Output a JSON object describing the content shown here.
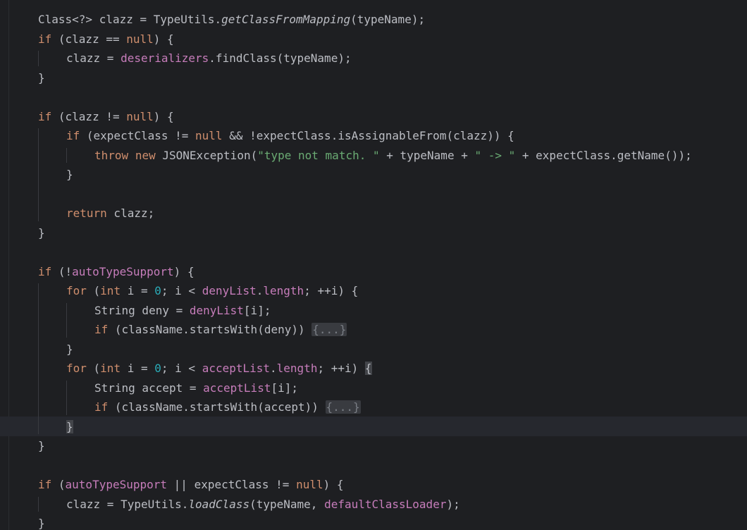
{
  "editor": {
    "language": "java",
    "colors": {
      "background": "#1e1f22",
      "text": "#bcbec4",
      "keyword": "#cf8e6d",
      "field": "#c77dbb",
      "number": "#2aacb8",
      "string": "#6aab73",
      "fold_placeholder_bg": "#393b40",
      "current_line": "#26282e"
    },
    "folded_placeholder": "{...}",
    "lines": [
      {
        "indent": 1,
        "tokens": [
          {
            "t": "Class<?> clazz = TypeUtils."
          },
          {
            "t": "getClassFromMapping",
            "s": "it"
          },
          {
            "t": "(typeName);"
          }
        ]
      },
      {
        "indent": 1,
        "tokens": [
          {
            "t": "if",
            "s": "kw"
          },
          {
            "t": " (clazz == "
          },
          {
            "t": "null",
            "s": "kw"
          },
          {
            "t": ") {"
          }
        ]
      },
      {
        "indent": 2,
        "tokens": [
          {
            "t": "clazz = "
          },
          {
            "t": "deserializers",
            "s": "fld"
          },
          {
            "t": ".findClass(typeName);"
          }
        ]
      },
      {
        "indent": 1,
        "tokens": [
          {
            "t": "}"
          }
        ]
      },
      {
        "indent": 0,
        "tokens": []
      },
      {
        "indent": 1,
        "tokens": [
          {
            "t": "if",
            "s": "kw"
          },
          {
            "t": " (clazz != "
          },
          {
            "t": "null",
            "s": "kw"
          },
          {
            "t": ") {"
          }
        ]
      },
      {
        "indent": 2,
        "tokens": [
          {
            "t": "if",
            "s": "kw"
          },
          {
            "t": " (expectClass != "
          },
          {
            "t": "null",
            "s": "kw"
          },
          {
            "t": " && !expectClass.isAssignableFrom(clazz)) {"
          }
        ]
      },
      {
        "indent": 3,
        "tokens": [
          {
            "t": "throw",
            "s": "kw"
          },
          {
            "t": " "
          },
          {
            "t": "new",
            "s": "kw"
          },
          {
            "t": " JSONException("
          },
          {
            "t": "\"type not match. \"",
            "s": "str"
          },
          {
            "t": " + typeName + "
          },
          {
            "t": "\" -> \"",
            "s": "str"
          },
          {
            "t": " + expectClass.getName());"
          }
        ]
      },
      {
        "indent": 2,
        "tokens": [
          {
            "t": "}"
          }
        ]
      },
      {
        "indent": 0,
        "tokens": []
      },
      {
        "indent": 2,
        "tokens": [
          {
            "t": "return",
            "s": "kw"
          },
          {
            "t": " clazz;"
          }
        ]
      },
      {
        "indent": 1,
        "tokens": [
          {
            "t": "}"
          }
        ]
      },
      {
        "indent": 0,
        "tokens": []
      },
      {
        "indent": 1,
        "tokens": [
          {
            "t": "if",
            "s": "kw"
          },
          {
            "t": " (!"
          },
          {
            "t": "autoTypeSupport",
            "s": "fld"
          },
          {
            "t": ") {"
          }
        ]
      },
      {
        "indent": 2,
        "tokens": [
          {
            "t": "for",
            "s": "kw"
          },
          {
            "t": " ("
          },
          {
            "t": "int",
            "s": "kw"
          },
          {
            "t": " i = "
          },
          {
            "t": "0",
            "s": "num"
          },
          {
            "t": "; i < "
          },
          {
            "t": "denyList",
            "s": "fld"
          },
          {
            "t": "."
          },
          {
            "t": "length",
            "s": "fld"
          },
          {
            "t": "; ++i) {"
          }
        ]
      },
      {
        "indent": 3,
        "tokens": [
          {
            "t": "String deny = "
          },
          {
            "t": "denyList",
            "s": "fld"
          },
          {
            "t": "[i];"
          }
        ]
      },
      {
        "indent": 3,
        "tokens": [
          {
            "t": "if",
            "s": "kw"
          },
          {
            "t": " (className.startsWith(deny)) "
          },
          {
            "t": "{...}",
            "s": "fold"
          }
        ]
      },
      {
        "indent": 2,
        "tokens": [
          {
            "t": "}"
          }
        ]
      },
      {
        "indent": 2,
        "tokens": [
          {
            "t": "for",
            "s": "kw"
          },
          {
            "t": " ("
          },
          {
            "t": "int",
            "s": "kw"
          },
          {
            "t": " i = "
          },
          {
            "t": "0",
            "s": "num"
          },
          {
            "t": "; i < "
          },
          {
            "t": "acceptList",
            "s": "fld"
          },
          {
            "t": "."
          },
          {
            "t": "length",
            "s": "fld"
          },
          {
            "t": "; ++i) "
          },
          {
            "t": "{",
            "s": "brace"
          }
        ]
      },
      {
        "indent": 3,
        "tokens": [
          {
            "t": "String accept = "
          },
          {
            "t": "acceptList",
            "s": "fld"
          },
          {
            "t": "[i];"
          }
        ]
      },
      {
        "indent": 3,
        "tokens": [
          {
            "t": "if",
            "s": "kw"
          },
          {
            "t": " (className.startsWith(accept)) "
          },
          {
            "t": "{...}",
            "s": "fold"
          }
        ]
      },
      {
        "indent": 2,
        "current": true,
        "tokens": [
          {
            "t": "}",
            "s": "brace"
          }
        ]
      },
      {
        "indent": 1,
        "tokens": [
          {
            "t": "}"
          }
        ]
      },
      {
        "indent": 0,
        "tokens": []
      },
      {
        "indent": 1,
        "tokens": [
          {
            "t": "if",
            "s": "kw"
          },
          {
            "t": " ("
          },
          {
            "t": "autoTypeSupport",
            "s": "fld"
          },
          {
            "t": " || expectClass != "
          },
          {
            "t": "null",
            "s": "kw"
          },
          {
            "t": ") {"
          }
        ]
      },
      {
        "indent": 2,
        "tokens": [
          {
            "t": "clazz = TypeUtils."
          },
          {
            "t": "loadClass",
            "s": "it"
          },
          {
            "t": "(typeName, "
          },
          {
            "t": "defaultClassLoader",
            "s": "fld"
          },
          {
            "t": ");"
          }
        ]
      },
      {
        "indent": 1,
        "tokens": [
          {
            "t": "}"
          }
        ]
      }
    ]
  }
}
